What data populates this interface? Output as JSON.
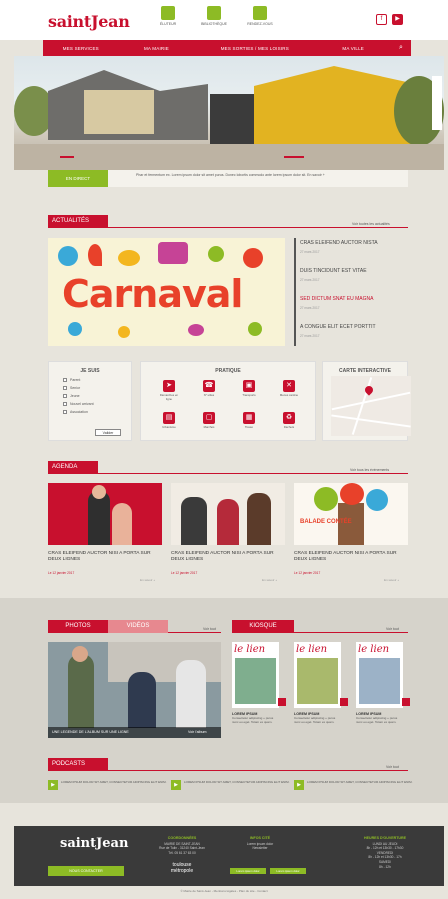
{
  "header": {
    "logo": "saintJean",
    "quick_links": [
      "ÉLUTEUR",
      "BIBLIOTHÈQUE",
      "RENDEZ-VOUS"
    ],
    "social": [
      "f",
      "▶"
    ]
  },
  "nav": {
    "items": [
      "MES SERVICES",
      "MA MAIRIE",
      "MES SORTIES / MES LOISIRS",
      "MA VILLE"
    ],
    "search_icon": "⌕"
  },
  "hero_strip": {
    "button": "EN DIRECT",
    "text": "Phar et fermentum ex. Lorem ipsum dolor sit amet purus. Donec lobortis commodo ante lorem ipsum dolor sit. En savoir +"
  },
  "actualites": {
    "title": "ACTUALITÉS",
    "link": "Voir toutes les actualités",
    "feature": "Carnaval",
    "news": [
      {
        "title": "CRAS ELEIFEND AUCTOR NISTA",
        "date": "27 mars 2017"
      },
      {
        "title": "DUIS TINCIDUNT EST VITAE",
        "date": "27 mars 2017"
      },
      {
        "title": "SED DICTUM SNAT EU MAGNA",
        "date": "27 mars 2017"
      },
      {
        "title": "A CONGUE ELIT ECET PORTTIT",
        "date": "27 mars 2017"
      }
    ]
  },
  "je_suis": {
    "title": "JE SUIS",
    "options": [
      "Parent",
      "Senior",
      "Jeune",
      "Nouvel arrivant",
      "Association"
    ],
    "button": "Valider"
  },
  "pratique": {
    "title": "PRATIQUE",
    "items": [
      {
        "icon": "cursor-icon",
        "glyph": "➤",
        "label": "Démarches en ligne"
      },
      {
        "icon": "phone-icon",
        "glyph": "☎",
        "label": "N° utiles"
      },
      {
        "icon": "bus-icon",
        "glyph": "▣",
        "label": "Transports"
      },
      {
        "icon": "fork-icon",
        "glyph": "✕",
        "label": "Menus cantine"
      },
      {
        "icon": "doc-icon",
        "glyph": "▤",
        "label": "Urbanisme"
      },
      {
        "icon": "bag-icon",
        "glyph": "▢",
        "label": "Marchés"
      },
      {
        "icon": "bus2-icon",
        "glyph": "▦",
        "label": "Tisséo"
      },
      {
        "icon": "trash-icon",
        "glyph": "♻",
        "label": "Déchets"
      }
    ]
  },
  "carte": {
    "title": "CARTE INTERACTIVE"
  },
  "agenda": {
    "title": "AGENDA",
    "link": "Voir tous les événements",
    "events": [
      {
        "title": "CRAS ELEIFEND AUCTOR NISI A PORTA SUR DEUX LIGNES",
        "date": "Le 12 janvier 2017",
        "more": "En savoir +"
      },
      {
        "title": "CRAS ELEIFEND AUCTOR NISI A PORTA SUR DEUX LIGNES",
        "date": "Le 12 janvier 2017",
        "more": "En savoir +"
      },
      {
        "title": "CRAS ELEIFEND AUCTOR NISI A PORTA SUR DEUX LIGNES",
        "date": "Le 12 janvier 2017",
        "more": "En savoir +"
      }
    ],
    "poster_text": "BALADE CONTÉE"
  },
  "media": {
    "tab_photos": "PHOTOS",
    "tab_videos": "VIDÉOS",
    "link": "Voir tout",
    "caption": "UNE LEGENDE DE L'ALBUM SUR UNE LIGNE",
    "caption_right": "Voir l'album"
  },
  "kiosque": {
    "title": "KIOSQUE",
    "link": "Voir tout",
    "mag_title": "le lien",
    "items": [
      {
        "title": "LOREM IPSUM",
        "text": "Consectetur adipiscing + purus nunc eu eget. Totam ex quam."
      },
      {
        "title": "LOREM IPSUM",
        "text": "Consectetur adipiscing + purus nunc eu eget. Totam ex quam."
      },
      {
        "title": "LOREM IPSUM",
        "text": "Consectetur adipiscing + purus nunc eu eget. Totam ex quam."
      }
    ]
  },
  "podcasts": {
    "title": "PODCASTS",
    "link": "Voir tout",
    "items": [
      "LOREM IPSUM DOLOR SIT AMET, CONSECTETUR ADIPISCING ELIT ENIM.",
      "LOREM IPSUM DOLOR SIT AMET, CONSECTETUR ADIPISCING ELIT ENIM.",
      "LOREM IPSUM DOLOR SIT AMET, CONSECTETUR ADIPISCING ELIT ENIM."
    ]
  },
  "footer": {
    "logo": "saintJean",
    "button": "NOUS CONTACTER",
    "partner": "toulouse métropole",
    "col1": {
      "title": "COORDONNÉES",
      "lines": [
        "MAIRIE DE SAINT-JEAN",
        "Rue de Tulin - 31240 Saint-Jean",
        "Tél. 05 61 37 63 00"
      ]
    },
    "col2": {
      "title": "INFOS CITÉ",
      "lines": [
        "Lorem ipsum dolor",
        "Newsletter"
      ]
    },
    "col2_buttons": [
      "Lorem ipsum dolor",
      "Lorem ipsum dolor"
    ],
    "col3": {
      "title": "HEURES D'OUVERTURE",
      "lines": [
        "LUNDI AU JEUDI",
        "8h - 12h et 13h30 - 17h30",
        "VENDREDI",
        "8h - 12h et 13h30 - 17h",
        "SAMEDI",
        "8h - 12h"
      ]
    },
    "copyright": "© Mairie de Saint-Jean - Mentions légales - Plan du site - Contact"
  },
  "colors": {
    "brand": "#c8102e",
    "accent": "#8dbb25",
    "footer": "#3a3a3a"
  }
}
